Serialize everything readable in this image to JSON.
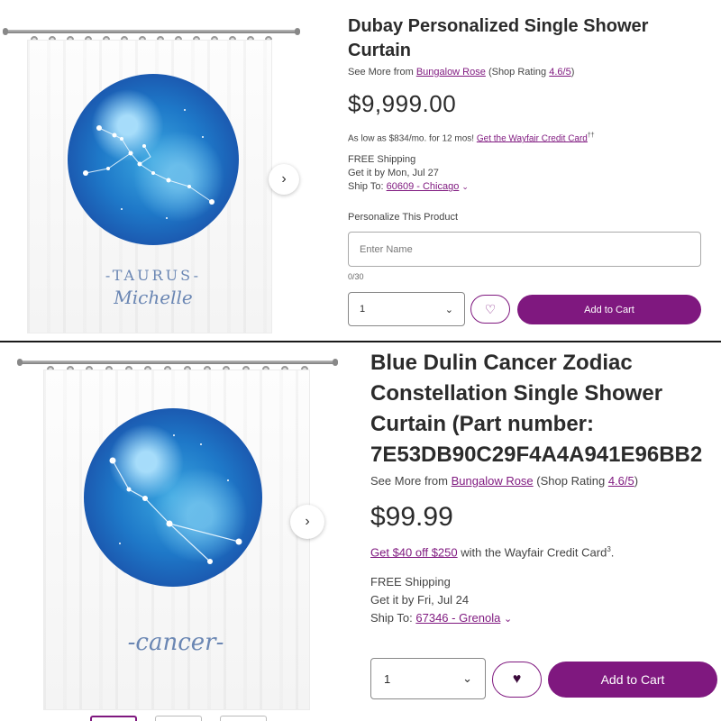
{
  "top": {
    "product_title": "Dubay Personalized Single Shower Curtain",
    "see_more_prefix": "See More from",
    "brand": "Bungalow Rose",
    "rating_prefix": "(Shop Rating",
    "rating": "4.6/5",
    "rating_suffix": ")",
    "price": "$9,999.00",
    "financing_text": "As low as $834/mo. for 12 mos!",
    "financing_link": "Get the Wayfair Credit Card",
    "financing_mark": "††",
    "shipping": "FREE Shipping",
    "delivery": "Get it by Mon, Jul 27",
    "ship_to_label": "Ship To:",
    "ship_to_link": "60609 - Chicago",
    "personalize_label": "Personalize This Product",
    "name_placeholder": "Enter Name",
    "char_count": "0/30",
    "quantity": "1",
    "add_to_cart": "Add to Cart",
    "curtain_sign": "TAURUS",
    "curtain_name": "Michelle"
  },
  "bottom": {
    "product_title_lines": [
      "Blue Dulin Cancer Zodiac",
      "Constellation Single Shower",
      "Curtain (Part number:",
      "7E53DB90C29F4A4A941E96BB2"
    ],
    "see_more_prefix": "See More from",
    "brand": "Bungalow Rose",
    "rating_prefix": "(Shop Rating",
    "rating": "4.6/5",
    "rating_suffix": ")",
    "price": "$99.99",
    "offer_link": "Get $40 off $250",
    "offer_text": "with the Wayfair Credit Card",
    "offer_mark": "3",
    "offer_end": ".",
    "shipping": "FREE Shipping",
    "delivery": "Get it by Fri, Jul 24",
    "ship_to_label": "Ship To:",
    "ship_to_link": "67346 - Grenola",
    "quantity": "1",
    "add_to_cart": "Add to Cart",
    "curtain_sign": "cancer"
  },
  "icons": {
    "carousel_next": "chevron-right-icon",
    "dropdown": "chevron-down-icon",
    "heart_outline": "heart-outline-icon",
    "heart_filled": "heart-filled-icon"
  },
  "colors": {
    "accent": "#7f187f",
    "globe": "#1e78c8"
  }
}
